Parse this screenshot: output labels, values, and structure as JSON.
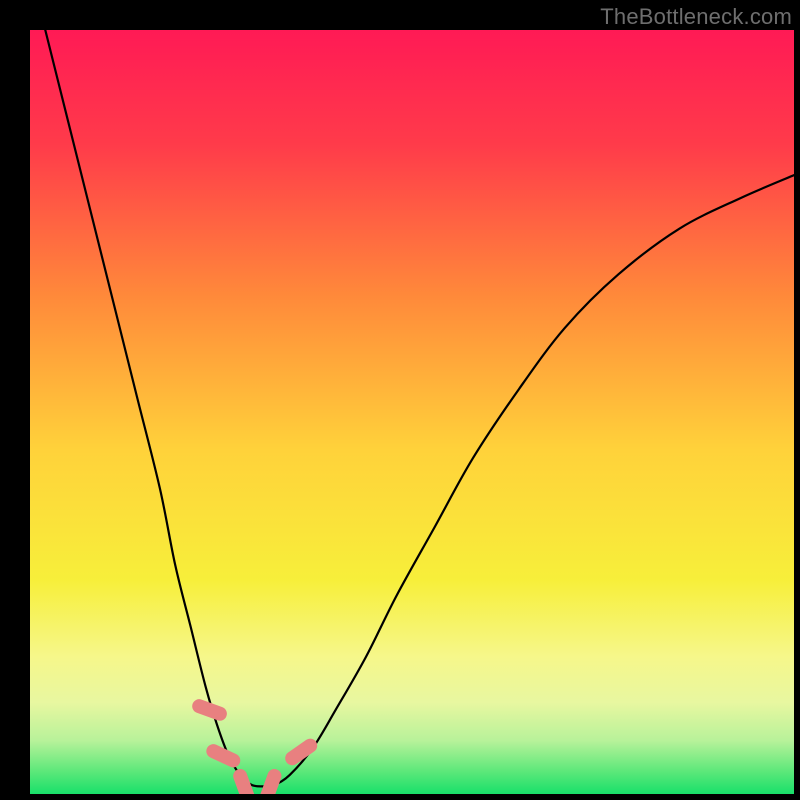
{
  "watermark": "TheBottleneck.com",
  "chart_data": {
    "type": "line",
    "title": "",
    "xlabel": "",
    "ylabel": "",
    "xlim": [
      0,
      100
    ],
    "ylim": [
      0,
      100
    ],
    "grid": false,
    "legend": "none",
    "series": [
      {
        "name": "bottleneck-curve",
        "color": "#000000",
        "x": [
          2,
          5,
          8,
          11,
          14,
          17,
          19,
          21,
          23,
          24.5,
          26,
          27.5,
          29,
          30.5,
          32,
          34,
          37,
          40,
          44,
          48,
          53,
          58,
          64,
          70,
          77,
          85,
          93,
          100
        ],
        "y": [
          100,
          88,
          76,
          64,
          52,
          40,
          30,
          22,
          14,
          9,
          5,
          2.5,
          1.2,
          1,
          1.2,
          2.5,
          6,
          11,
          18,
          26,
          35,
          44,
          53,
          61,
          68,
          74,
          78,
          81
        ]
      }
    ],
    "markers": [
      {
        "name": "marker-1",
        "x": 23.5,
        "y": 11,
        "angle": -70,
        "color": "#e88080"
      },
      {
        "name": "marker-2",
        "x": 25.3,
        "y": 5,
        "angle": -65,
        "color": "#e88080"
      },
      {
        "name": "marker-3",
        "x": 28.0,
        "y": 1.0,
        "angle": -20,
        "color": "#e88080"
      },
      {
        "name": "marker-4",
        "x": 31.5,
        "y": 1.0,
        "angle": 20,
        "color": "#e88080"
      },
      {
        "name": "marker-5",
        "x": 35.5,
        "y": 5.5,
        "angle": 55,
        "color": "#e88080"
      }
    ],
    "background_gradient": {
      "stops": [
        {
          "offset": 0.0,
          "color": "#ff1a55"
        },
        {
          "offset": 0.15,
          "color": "#ff3b4a"
        },
        {
          "offset": 0.35,
          "color": "#ff8a3a"
        },
        {
          "offset": 0.55,
          "color": "#ffd23a"
        },
        {
          "offset": 0.72,
          "color": "#f7ef3a"
        },
        {
          "offset": 0.82,
          "color": "#f6f78a"
        },
        {
          "offset": 0.88,
          "color": "#e8f7a0"
        },
        {
          "offset": 0.93,
          "color": "#b8f29a"
        },
        {
          "offset": 0.97,
          "color": "#5de87a"
        },
        {
          "offset": 1.0,
          "color": "#18e06a"
        }
      ]
    }
  }
}
